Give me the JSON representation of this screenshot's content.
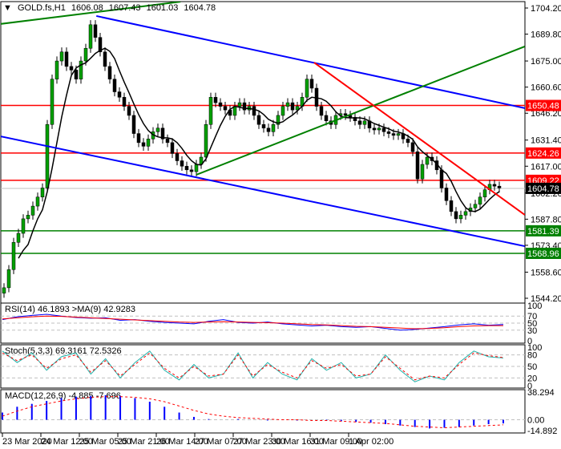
{
  "header": {
    "symbol": "GOLD.fs,H1",
    "open": "1606.08",
    "high": "1607.43",
    "low": "1601.03",
    "close": "1604.78"
  },
  "chart_data": {
    "type": "candlestick",
    "title": "GOLD.fs,H1",
    "ylim": [
      1544.2,
      1704.2
    ],
    "price_ticks": [
      "1704.20",
      "1689.80",
      "1675.00",
      "1660.60",
      "1646.20",
      "1631.40",
      "1617.00",
      "1602.20",
      "1587.80",
      "1573.40",
      "1558.60",
      "1544.20"
    ],
    "time_labels": [
      "23 Mar 2020",
      "24 Mar 12:00",
      "25 Mar 05:00",
      "25 Mar 21:00",
      "26 Mar 14:00",
      "27 Mar 07:00",
      "27 Mar 23:00",
      "30 Mar 16:00",
      "31 Mar 09:00",
      "1 Apr 02:00"
    ],
    "closes": [
      1550,
      1560,
      1575,
      1580,
      1588,
      1590,
      1595,
      1600,
      1605,
      1640,
      1665,
      1675,
      1680,
      1672,
      1670,
      1665,
      1675,
      1682,
      1695,
      1688,
      1680,
      1672,
      1665,
      1658,
      1655,
      1650,
      1645,
      1635,
      1630,
      1628,
      1632,
      1636,
      1638,
      1632,
      1630,
      1624,
      1620,
      1617,
      1615,
      1614,
      1618,
      1622,
      1640,
      1655,
      1652,
      1650,
      1648,
      1645,
      1650,
      1652,
      1648,
      1650,
      1645,
      1640,
      1638,
      1636,
      1640,
      1645,
      1650,
      1652,
      1648,
      1650,
      1655,
      1665,
      1660,
      1650,
      1645,
      1642,
      1640,
      1645,
      1646,
      1645,
      1644,
      1642,
      1640,
      1642,
      1638,
      1637,
      1638,
      1636,
      1635,
      1634,
      1635,
      1632,
      1630,
      1625,
      1610,
      1618,
      1622,
      1620,
      1615,
      1605,
      1598,
      1592,
      1588,
      1590,
      1592,
      1594,
      1596,
      1600,
      1604,
      1607,
      1606,
      1605
    ],
    "levels": [
      {
        "price": 1650.48,
        "label": "1650.48",
        "color": "#ff0000"
      },
      {
        "price": 1624.26,
        "label": "1624.26",
        "color": "#ff0000"
      },
      {
        "price": 1609.22,
        "label": "1609.22",
        "color": "#ff0000"
      },
      {
        "price": 1581.39,
        "label": "1581.39",
        "color": "#008000"
      },
      {
        "price": 1568.96,
        "label": "1568.96",
        "color": "#008000"
      }
    ],
    "current": {
      "price": 1604.78,
      "label": "1604.78"
    },
    "trendlines": [
      {
        "name": "upper-channel",
        "color": "#0000ff",
        "from": [
          19.2,
          1699.8
        ],
        "to": [
          108.3,
          1649.0
        ]
      },
      {
        "name": "lower-channel",
        "color": "#0000ff",
        "from": [
          -0.8,
          1633.5
        ],
        "to": [
          108.3,
          1572.9
        ]
      },
      {
        "name": "green-top",
        "color": "#008000",
        "from": [
          -0.8,
          1695.4
        ],
        "to": [
          36.7,
          1707.7
        ]
      },
      {
        "name": "green-support",
        "color": "#008000",
        "from": [
          40,
          1612.3
        ],
        "to": [
          108.3,
          1683.0
        ]
      },
      {
        "name": "red-resistance",
        "color": "#ff0000",
        "from": [
          64.5,
          1674.1
        ],
        "to": [
          108.3,
          1590.2
        ]
      }
    ],
    "rsi": {
      "label": "RSI(14) 46.1893 >MA(9) 42.9283",
      "ticks": [
        "100",
        "70",
        "50",
        "30",
        "0"
      ],
      "values": [
        60,
        68,
        72,
        75,
        70,
        66,
        64,
        65,
        58,
        60,
        55,
        52,
        50,
        48,
        55,
        60,
        52,
        50,
        53,
        48,
        45,
        42,
        44,
        40,
        38,
        40,
        35,
        30,
        32,
        36,
        40,
        45,
        48,
        44,
        46
      ],
      "ma": [
        62,
        65,
        68,
        70,
        69,
        67,
        65,
        63,
        61,
        59,
        57,
        55,
        53,
        52,
        53,
        54,
        53,
        52,
        51,
        50,
        48,
        46,
        45,
        43,
        41,
        40,
        38,
        36,
        34,
        35,
        37,
        40,
        42,
        43,
        43
      ]
    },
    "stoch": {
      "label": "Stoch(5,3,3) 69.3161 72.5326",
      "ticks": [
        "100",
        "80",
        "50",
        "20",
        "0"
      ],
      "main": [
        90,
        60,
        85,
        40,
        75,
        85,
        30,
        70,
        20,
        60,
        90,
        40,
        15,
        55,
        20,
        30,
        85,
        20,
        60,
        30,
        15,
        70,
        40,
        60,
        20,
        30,
        80,
        40,
        10,
        25,
        15,
        60,
        90,
        75,
        72
      ],
      "signal": [
        85,
        65,
        80,
        45,
        70,
        80,
        35,
        65,
        25,
        55,
        85,
        45,
        20,
        50,
        25,
        30,
        80,
        25,
        55,
        35,
        20,
        65,
        45,
        55,
        25,
        30,
        75,
        45,
        15,
        25,
        20,
        55,
        85,
        78,
        73
      ]
    },
    "macd": {
      "label": "MACD(12,26,9) -4.885 -7.696",
      "ticks": [
        "38.294",
        "0.00",
        "-14.892"
      ],
      "hist": [
        10,
        18,
        22,
        26,
        30,
        32,
        33,
        34,
        33,
        30,
        25,
        18,
        10,
        4,
        1,
        0,
        1,
        0,
        -1,
        0,
        -1,
        0,
        -1,
        -2,
        -3,
        -4,
        -6,
        -8,
        -10,
        -12,
        -11,
        -10,
        -8,
        -6,
        -5
      ],
      "signal": [
        5,
        12,
        18,
        22,
        26,
        29,
        31,
        32,
        32,
        31,
        29,
        25,
        19,
        13,
        8,
        5,
        3,
        2,
        1,
        0,
        0,
        -1,
        -1,
        -2,
        -3,
        -4,
        -5,
        -7,
        -9,
        -10,
        -11,
        -10,
        -9,
        -8,
        -7
      ]
    }
  }
}
